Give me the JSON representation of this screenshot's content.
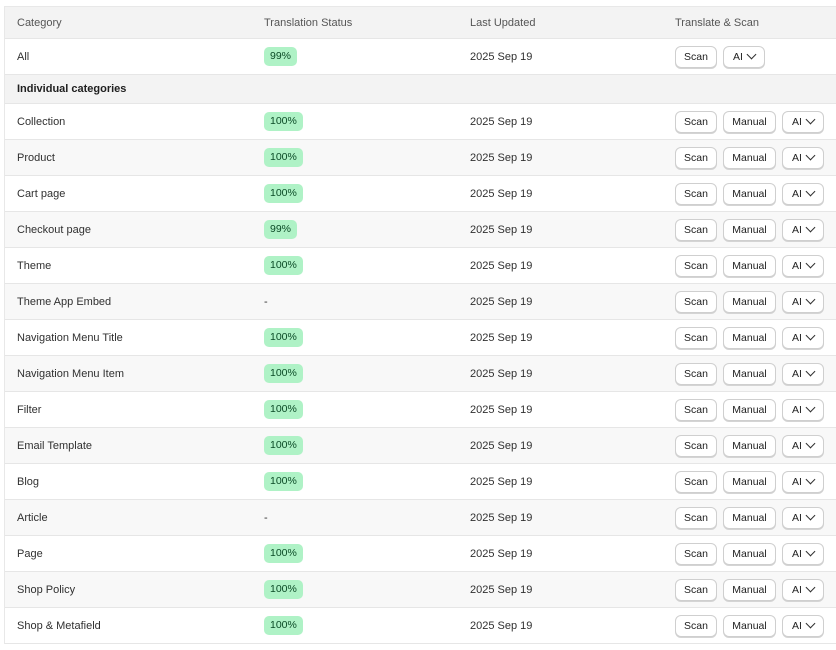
{
  "header": {
    "category": "Category",
    "status": "Translation Status",
    "updated": "Last Updated",
    "actions": "Translate & Scan"
  },
  "all_row": {
    "label": "All",
    "status": "99%",
    "updated": "2025 Sep 19",
    "scan": "Scan",
    "ai": "AI"
  },
  "section_title": "Individual categories",
  "buttons": {
    "scan": "Scan",
    "manual": "Manual",
    "ai": "AI"
  },
  "rows": [
    {
      "label": "Collection",
      "status": "100%",
      "updated": "2025 Sep 19"
    },
    {
      "label": "Product",
      "status": "100%",
      "updated": "2025 Sep 19"
    },
    {
      "label": "Cart page",
      "status": "100%",
      "updated": "2025 Sep 19"
    },
    {
      "label": "Checkout page",
      "status": "99%",
      "updated": "2025 Sep 19"
    },
    {
      "label": "Theme",
      "status": "100%",
      "updated": "2025 Sep 19"
    },
    {
      "label": "Theme App Embed",
      "status": "-",
      "updated": "2025 Sep 19"
    },
    {
      "label": "Navigation Menu Title",
      "status": "100%",
      "updated": "2025 Sep 19"
    },
    {
      "label": "Navigation Menu Item",
      "status": "100%",
      "updated": "2025 Sep 19"
    },
    {
      "label": "Filter",
      "status": "100%",
      "updated": "2025 Sep 19"
    },
    {
      "label": "Email Template",
      "status": "100%",
      "updated": "2025 Sep 19"
    },
    {
      "label": "Blog",
      "status": "100%",
      "updated": "2025 Sep 19"
    },
    {
      "label": "Article",
      "status": "-",
      "updated": "2025 Sep 19"
    },
    {
      "label": "Page",
      "status": "100%",
      "updated": "2025 Sep 19"
    },
    {
      "label": "Shop Policy",
      "status": "100%",
      "updated": "2025 Sep 19"
    },
    {
      "label": "Shop & Metafield",
      "status": "100%",
      "updated": "2025 Sep 19"
    }
  ],
  "colors": {
    "badge_bg": "#aff2c6",
    "badge_text": "#0b4a26"
  }
}
